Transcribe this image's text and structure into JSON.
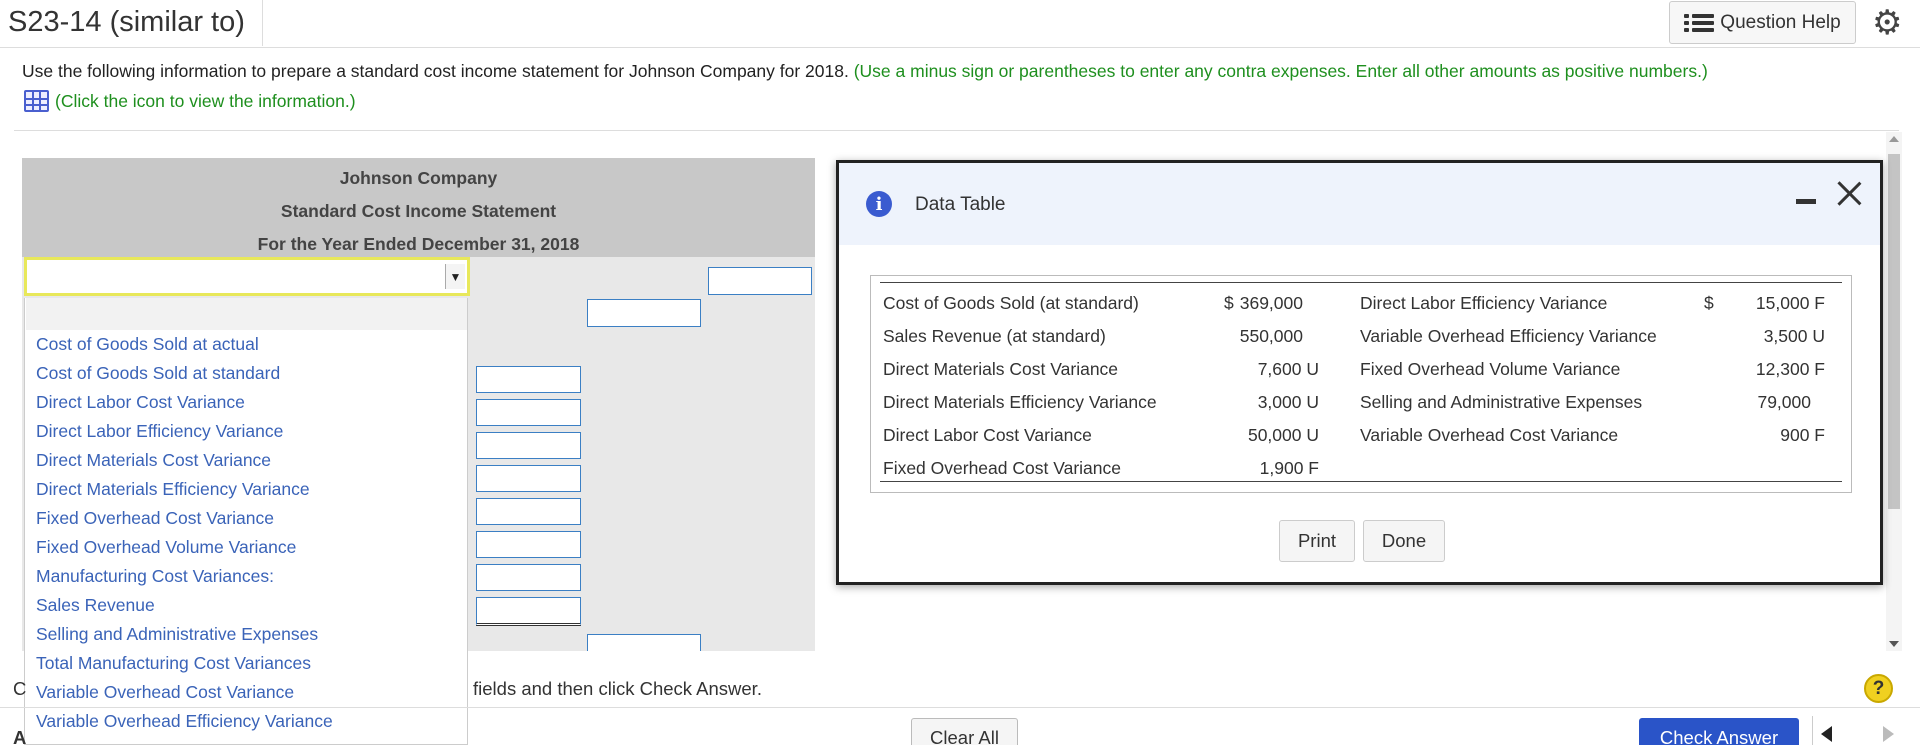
{
  "header": {
    "title": "S23-14 (similar to)",
    "question_help": "Question Help",
    "icons": {
      "list": "list-icon",
      "settings": "gear-icon"
    }
  },
  "instructions": {
    "main": "Use the following information to prepare a standard cost income statement for Johnson Company for 2018.",
    "note": "(Use a minus sign or parentheses to enter any contra expenses. Enter all other amounts as positive numbers.)",
    "click_info": "(Click the icon to view the information.)",
    "colors": {
      "note": "#1e8f1e",
      "link": "#3a63b8"
    }
  },
  "statement": {
    "company": "Johnson Company",
    "title": "Standard Cost Income Statement",
    "period": "For the Year Ended December 31, 2018",
    "dropdown_selected": "",
    "dropdown_options": [
      "Cost of Goods Sold at actual",
      "Cost of Goods Sold at standard",
      "Direct Labor Cost Variance",
      "Direct Labor Efficiency Variance",
      "Direct Materials Cost Variance",
      "Direct Materials Efficiency Variance",
      "Fixed Overhead Cost Variance",
      "Fixed Overhead Volume Variance",
      "Manufacturing Cost Variances:",
      "Sales Revenue",
      "Selling and Administrative Expenses",
      "Total Manufacturing Cost Variances",
      "Variable Overhead Cost Variance",
      "Variable Overhead Efficiency Variance"
    ]
  },
  "modal": {
    "title": "Data Table",
    "rows_left": [
      {
        "label": "Cost of Goods Sold (at standard)",
        "prefix": "$",
        "amount": "369,000"
      },
      {
        "label": "Sales Revenue (at standard)",
        "prefix": "",
        "amount": "550,000"
      },
      {
        "label": "Direct Materials Cost Variance",
        "prefix": "",
        "amount": "7,600 U"
      },
      {
        "label": "Direct Materials Efficiency Variance",
        "prefix": "",
        "amount": "3,000 U"
      },
      {
        "label": "Direct Labor Cost Variance",
        "prefix": "",
        "amount": "50,000 U"
      },
      {
        "label": "Fixed Overhead Cost Variance",
        "prefix": "",
        "amount": "1,900 F"
      }
    ],
    "rows_right": [
      {
        "label": "Direct Labor Efficiency Variance",
        "prefix": "$",
        "amount": "15,000 F"
      },
      {
        "label": "Variable Overhead Efficiency Variance",
        "prefix": "",
        "amount": "3,500 U"
      },
      {
        "label": "Fixed Overhead Volume Variance",
        "prefix": "",
        "amount": "12,300 F"
      },
      {
        "label": "Selling and Administrative Expenses",
        "prefix": "",
        "amount": "79,000"
      },
      {
        "label": "Variable Overhead Cost Variance",
        "prefix": "",
        "amount": "900 F"
      }
    ],
    "print_label": "Print",
    "done_label": "Done",
    "icons": {
      "info": "info-icon",
      "minimize": "minimize-icon",
      "close": "close-icon"
    }
  },
  "footer": {
    "prompt_start": "C",
    "prompt_end": "fields and then click Check Answer.",
    "answer_letter": "A",
    "help_symbol": "?",
    "clear_all": "Clear All",
    "check_answer": "Check Answer",
    "accent_color": "#2a54c8"
  }
}
